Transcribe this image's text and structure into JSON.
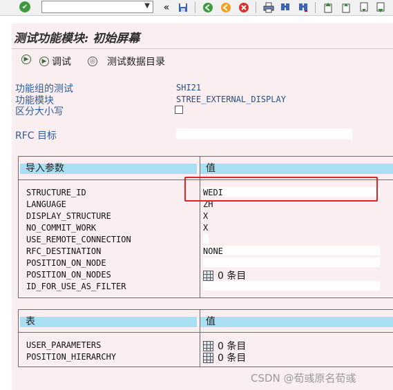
{
  "toolbar": {
    "command_field_value": "",
    "icons": [
      "enter-icon",
      "back-arrow-icon",
      "save-icon",
      "back-icon",
      "exit-icon",
      "cancel-icon",
      "print-icon",
      "find-icon",
      "find-next-icon",
      "first-page-icon",
      "prev-page-icon",
      "next-page-icon",
      "last-page-icon"
    ],
    "glyphs": {
      "enter": "✔",
      "dropdown": "▼",
      "back_arrow": "«",
      "save": "💾",
      "back": "◀",
      "exit": "✖",
      "cancel": "✖",
      "print": "⎙",
      "find": "⌕",
      "find_next": "⌕",
      "first": "⤒",
      "prev": "↑",
      "next": "↓",
      "last": "⤓"
    }
  },
  "title": "测试功能模块: 初始屏幕",
  "appbar": {
    "debug_label": "调试",
    "testdata_label": "测试数据目录",
    "execute_glyph": "▶",
    "debug_glyph": "▶",
    "testdata_glyph": "◎"
  },
  "header_fields": {
    "group_label": "功能组的测试",
    "group_value": "SHI21",
    "module_label": "功能模块",
    "module_value": "STREE_EXTERNAL_DISPLAY",
    "case_label": "区分大小写",
    "rfc_label": "RFC 目标",
    "rfc_value": ""
  },
  "import_params": {
    "header_left": "导入参数",
    "header_right": "值",
    "rows": [
      {
        "name": "STRUCTURE_ID",
        "value": "WEDI"
      },
      {
        "name": "LANGUAGE",
        "value": "ZH"
      },
      {
        "name": "DISPLAY_STRUCTURE",
        "value": "X"
      },
      {
        "name": "NO_COMMIT_WORK",
        "value": "X"
      },
      {
        "name": "USE_REMOTE_CONNECTION",
        "value": ""
      },
      {
        "name": "RFC_DESTINATION",
        "value": "NONE"
      },
      {
        "name": "POSITION_ON_NODE",
        "value": ""
      },
      {
        "name": "POSITION_ON_NODES",
        "value": "0 条目"
      },
      {
        "name": "ID_FOR_USE_AS_FILTER",
        "value": ""
      }
    ]
  },
  "tables": {
    "header_left": "表",
    "header_right": "值",
    "rows": [
      {
        "name": "USER_PARAMETERS",
        "value": "0 条目"
      },
      {
        "name": "POSITION_HIERARCHY",
        "value": "0 条目"
      }
    ]
  },
  "colors": {
    "highlight_box": "#e02323",
    "header_bg": "#a8e0f2",
    "screen_bg": "#fbeef0"
  },
  "watermark": "CSDN @荀彧原名荀彧"
}
